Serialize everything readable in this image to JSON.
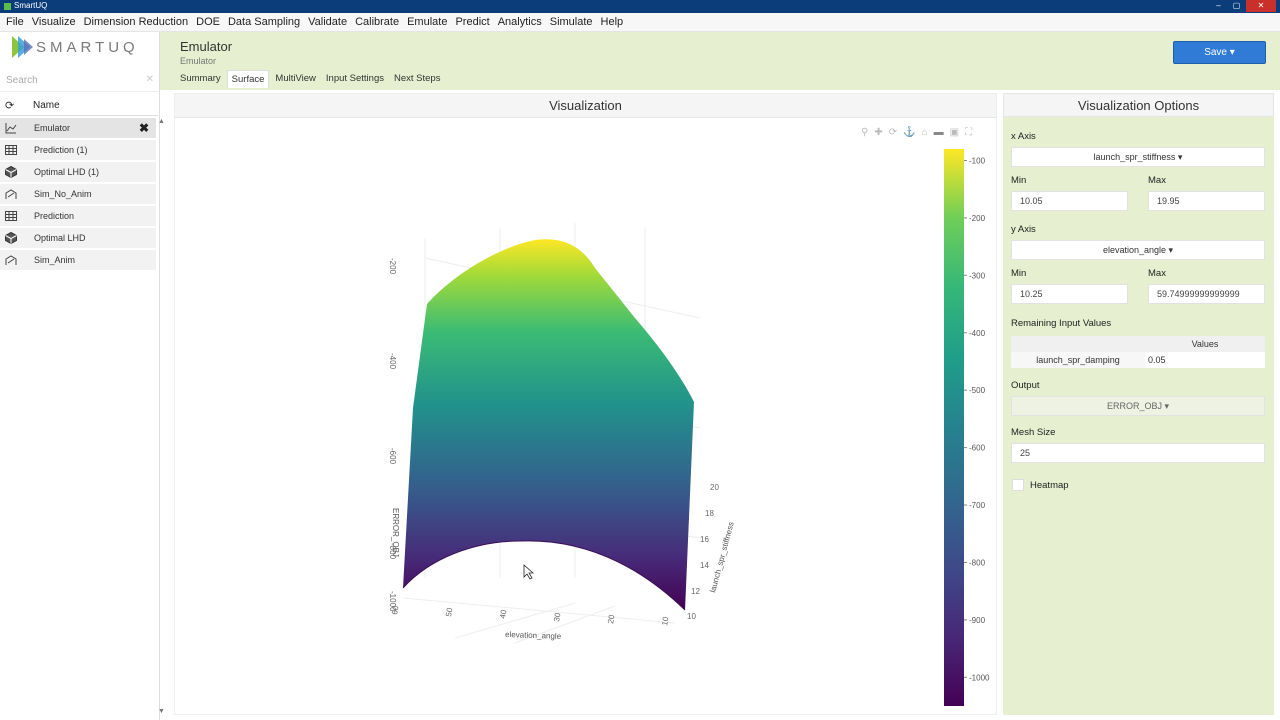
{
  "window": {
    "title": "SmartUQ"
  },
  "menu": [
    "File",
    "Visualize",
    "Dimension Reduction",
    "DOE",
    "Data Sampling",
    "Validate",
    "Calibrate",
    "Emulate",
    "Predict",
    "Analytics",
    "Simulate",
    "Help"
  ],
  "logo": {
    "text": "SMARTUQ"
  },
  "sidebar": {
    "search_placeholder": "Search",
    "column_header": "Name",
    "items": [
      {
        "label": "Emulator",
        "icon": "chart-line-icon",
        "active": true
      },
      {
        "label": "Prediction (1)",
        "icon": "table-icon"
      },
      {
        "label": "Optimal LHD (1)",
        "icon": "cube-grid-icon"
      },
      {
        "label": "Sim_No_Anim",
        "icon": "simulation-icon"
      },
      {
        "label": "Prediction",
        "icon": "table-icon"
      },
      {
        "label": "Optimal LHD",
        "icon": "cube-grid-icon"
      },
      {
        "label": "Sim_Anim",
        "icon": "simulation-icon"
      }
    ]
  },
  "header": {
    "title": "Emulator",
    "subtitle": "Emulator",
    "save_label": "Save ▾",
    "tabs": [
      "Summary",
      "Surface",
      "MultiView",
      "Input Settings",
      "Next Steps"
    ],
    "active_tab": "Surface"
  },
  "viz": {
    "title": "Visualization"
  },
  "chart_data": {
    "type": "surface3d",
    "colorscale": "viridis",
    "x_axis": {
      "label": "launch_spr_stiffness",
      "ticks": [
        "10",
        "12",
        "14",
        "16",
        "18",
        "20"
      ]
    },
    "y_axis": {
      "label": "elevation_angle",
      "ticks": [
        "10",
        "20",
        "30",
        "40",
        "50",
        "60"
      ]
    },
    "z_axis": {
      "label": "ERROR_OBJ",
      "ticks": [
        "-1000",
        "-800",
        "-600",
        "-400",
        "-200"
      ]
    },
    "colorbar_ticks": [
      "-100",
      "-200",
      "-300",
      "-400",
      "-500",
      "-600",
      "-700",
      "-800",
      "-900",
      "-1000"
    ],
    "colorbar_range": [
      -1050,
      -80
    ]
  },
  "options": {
    "title": "Visualization Options",
    "x_axis_label": "x Axis",
    "x_axis_value": "launch_spr_stiffness ▾",
    "min_label": "Min",
    "max_label": "Max",
    "x_min": "10.05",
    "x_max": "19.95",
    "y_axis_label": "y Axis",
    "y_axis_value": "elevation_angle ▾",
    "y_min": "10.25",
    "y_max": "59.74999999999999",
    "remaining_label": "Remaining Input Values",
    "remaining_header": "Values",
    "remaining_name": "launch_spr_damping",
    "remaining_value": "0.05",
    "output_label": "Output",
    "output_value": "ERROR_OBJ ▾",
    "mesh_label": "Mesh Size",
    "mesh_value": "25",
    "heatmap_label": "Heatmap"
  }
}
